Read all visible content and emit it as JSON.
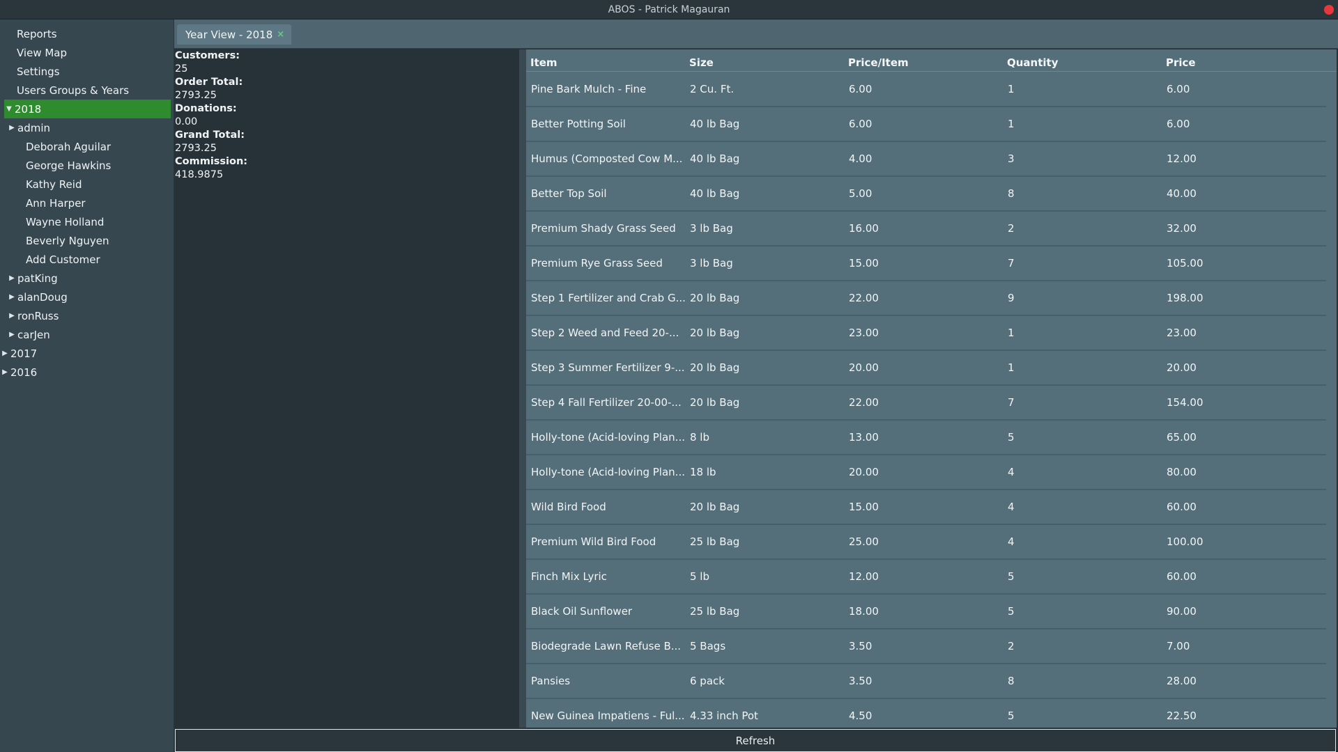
{
  "window": {
    "title": "ABOS - Patrick Magauran"
  },
  "sidebar": {
    "items": [
      {
        "label": "Reports",
        "level": 1,
        "arrow": "",
        "selected": false
      },
      {
        "label": "View Map",
        "level": 1,
        "arrow": "",
        "selected": false
      },
      {
        "label": "Settings",
        "level": 1,
        "arrow": "",
        "selected": false
      },
      {
        "label": "Users Groups & Years",
        "level": 1,
        "arrow": "",
        "selected": false
      },
      {
        "label": "2018",
        "level": 0,
        "arrow": "▼",
        "selected": true
      },
      {
        "label": "admin",
        "level": 1,
        "arrow": "▶",
        "selected": false
      },
      {
        "label": "Deborah Aguilar",
        "level": 2,
        "arrow": "",
        "selected": false
      },
      {
        "label": "George Hawkins",
        "level": 2,
        "arrow": "",
        "selected": false
      },
      {
        "label": "Kathy Reid",
        "level": 2,
        "arrow": "",
        "selected": false
      },
      {
        "label": "Ann Harper",
        "level": 2,
        "arrow": "",
        "selected": false
      },
      {
        "label": "Wayne Holland",
        "level": 2,
        "arrow": "",
        "selected": false
      },
      {
        "label": "Beverly Nguyen",
        "level": 2,
        "arrow": "",
        "selected": false
      },
      {
        "label": "Add Customer",
        "level": 2,
        "arrow": "",
        "selected": false
      },
      {
        "label": "patKing",
        "level": 1,
        "arrow": "▶",
        "selected": false
      },
      {
        "label": "alanDoug",
        "level": 1,
        "arrow": "▶",
        "selected": false
      },
      {
        "label": "ronRuss",
        "level": 1,
        "arrow": "▶",
        "selected": false
      },
      {
        "label": "carJen",
        "level": 1,
        "arrow": "▶",
        "selected": false
      },
      {
        "label": "2017",
        "level": 0,
        "arrow": "▶",
        "selected": false
      },
      {
        "label": "2016",
        "level": 0,
        "arrow": "▶",
        "selected": false
      }
    ]
  },
  "tab": {
    "label": "Year View - 2018",
    "close": "×"
  },
  "stats": {
    "customers_label": "Customers:",
    "customers": "25",
    "order_total_label": "Order Total:",
    "order_total": "2793.25",
    "donations_label": "Donations:",
    "donations": "0.00",
    "grand_total_label": "Grand Total:",
    "grand_total": "2793.25",
    "commission_label": "Commission:",
    "commission": "418.9875"
  },
  "table": {
    "headers": [
      "Item",
      "Size",
      "Price/Item",
      "Quantity",
      "Price"
    ],
    "rows": [
      [
        "Pine Bark Mulch - Fine",
        "2 Cu. Ft.",
        "6.00",
        "1",
        "6.00"
      ],
      [
        "Better Potting Soil",
        "40 lb Bag",
        "6.00",
        "1",
        "6.00"
      ],
      [
        "Humus (Composted Cow M...",
        "40 lb Bag",
        "4.00",
        "3",
        "12.00"
      ],
      [
        "Better Top Soil",
        "40 lb Bag",
        "5.00",
        "8",
        "40.00"
      ],
      [
        "Premium Shady Grass Seed",
        "3 lb Bag",
        "16.00",
        "2",
        "32.00"
      ],
      [
        "Premium Rye Grass Seed",
        "3 lb Bag",
        "15.00",
        "7",
        "105.00"
      ],
      [
        "Step 1 Fertilizer and Crab G...",
        "20 lb Bag",
        "22.00",
        "9",
        "198.00"
      ],
      [
        "Step 2 Weed and Feed 20-...",
        "20 lb Bag",
        "23.00",
        "1",
        "23.00"
      ],
      [
        "Step 3 Summer Fertilizer 9-...",
        "20 lb Bag",
        "20.00",
        "1",
        "20.00"
      ],
      [
        "Step 4 Fall Fertilizer 20-00-...",
        "20 lb Bag",
        "22.00",
        "7",
        "154.00"
      ],
      [
        "Holly-tone (Acid-loving Plan...",
        "8 lb",
        "13.00",
        "5",
        "65.00"
      ],
      [
        "Holly-tone (Acid-loving Plan...",
        "18 lb",
        "20.00",
        "4",
        "80.00"
      ],
      [
        "Wild Bird Food",
        "20 lb Bag",
        "15.00",
        "4",
        "60.00"
      ],
      [
        "Premium Wild Bird Food",
        "25 lb Bag",
        "25.00",
        "4",
        "100.00"
      ],
      [
        "Finch Mix Lyric",
        "5 lb",
        "12.00",
        "5",
        "60.00"
      ],
      [
        "Black Oil Sunflower",
        "25 lb Bag",
        "18.00",
        "5",
        "90.00"
      ],
      [
        "Biodegrade Lawn Refuse B...",
        "5 Bags",
        "3.50",
        "2",
        "7.00"
      ],
      [
        "Pansies",
        "6 pack",
        "3.50",
        "8",
        "28.00"
      ],
      [
        "New Guinea Impatiens - Ful...",
        "4.33 inch Pot",
        "4.50",
        "5",
        "22.50"
      ]
    ]
  },
  "refresh_label": "Refresh",
  "colors": {
    "selected": "#2e8b2e",
    "close": "#e8383d",
    "table_bg": "#546e7a"
  }
}
